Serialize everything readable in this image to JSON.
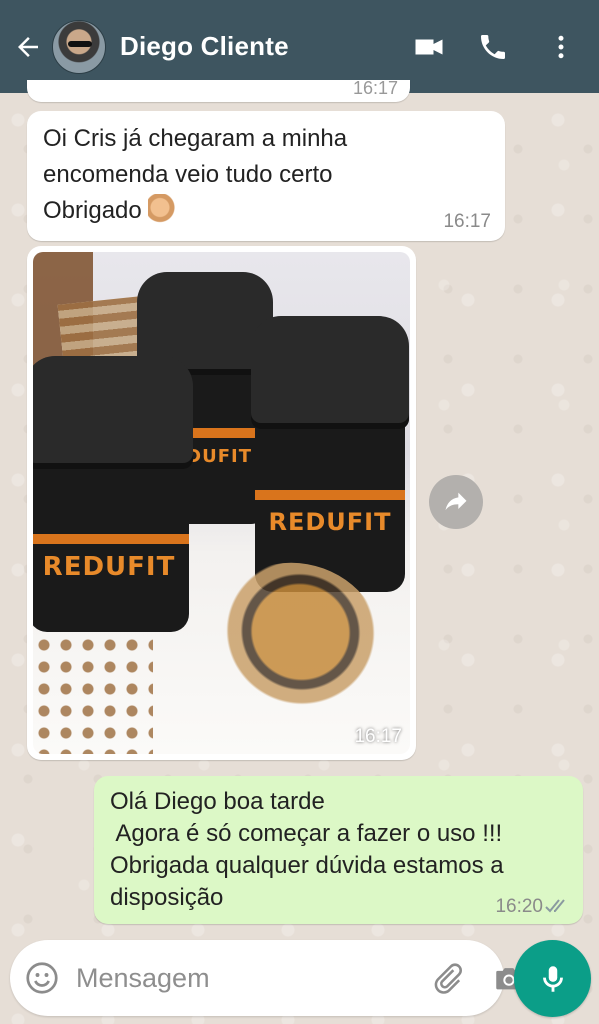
{
  "header": {
    "contact_name": "Diego Cliente",
    "icons": [
      "back-arrow-icon",
      "video-call-icon",
      "phone-icon",
      "more-vert-icon"
    ],
    "background": "#3e5560"
  },
  "messages": [
    {
      "direction": "incoming",
      "time": "16:17",
      "partial": true
    },
    {
      "direction": "incoming",
      "text_lines": [
        "Oi Cris já chegaram a minha",
        "encomenda veio tudo certo",
        "Obrigado"
      ],
      "emoji": "thumbs-up",
      "time": "16:17"
    },
    {
      "direction": "incoming",
      "type": "image",
      "image_text": "REDUFIT",
      "time": "16:17"
    },
    {
      "direction": "outgoing",
      "text_lines": [
        "Olá Diego boa tarde",
        " Agora é só começar a fazer o uso !!!",
        "Obrigada qualquer dúvida estamos a",
        "disposição"
      ],
      "time": "16:20",
      "status": "read-double-check"
    }
  ],
  "composer": {
    "placeholder": "Mensagem",
    "icons": [
      "emoji-icon",
      "attach-icon",
      "camera-icon",
      "mic-icon"
    ],
    "accent": "#0b9e88"
  },
  "colors": {
    "incoming_bubble": "#ffffff",
    "outgoing_bubble": "#dcf8c6",
    "chat_background": "#e6ded6"
  }
}
